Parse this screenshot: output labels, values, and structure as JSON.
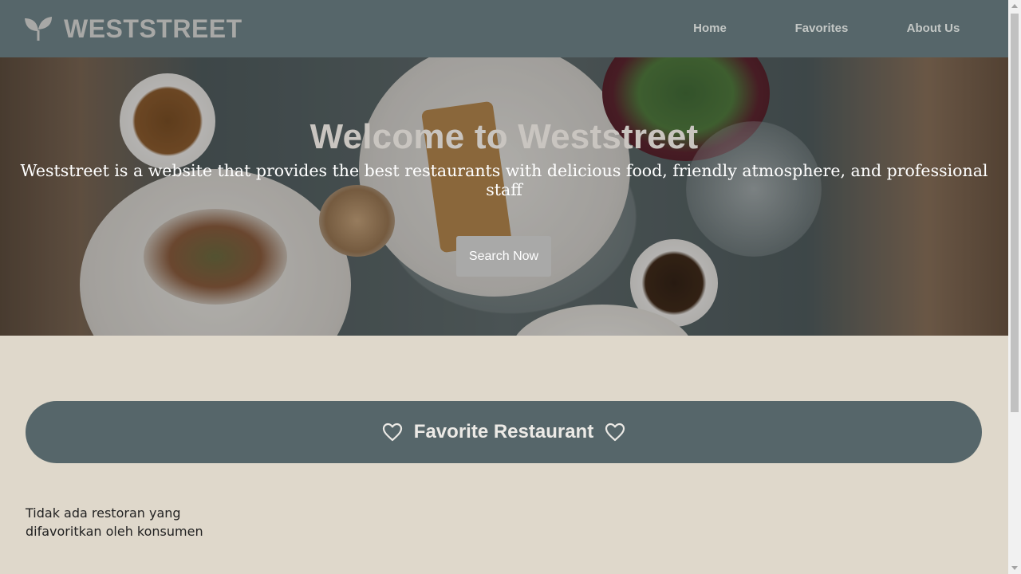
{
  "header": {
    "brand_name": "WESTSTREET",
    "logo_icon": "sprout-icon",
    "nav": [
      {
        "label": "Home"
      },
      {
        "label": "Favorites"
      },
      {
        "label": "About Us"
      }
    ]
  },
  "hero": {
    "title": "Welcome to Weststreet",
    "subtitle": "Weststreet is a website that provides the best restaurants with delicious food, friendly atmosphere, and professional staff",
    "button_label": "Search Now"
  },
  "favorites": {
    "title": "Favorite Restaurant",
    "icon": "heart-outline-icon",
    "empty_message": "Tidak ada restoran yang difavoritkan oleh konsumen"
  },
  "colors": {
    "header_bg": "#56666a",
    "page_bg": "#dfd8cb",
    "button_bg": "#a9a9a8"
  }
}
